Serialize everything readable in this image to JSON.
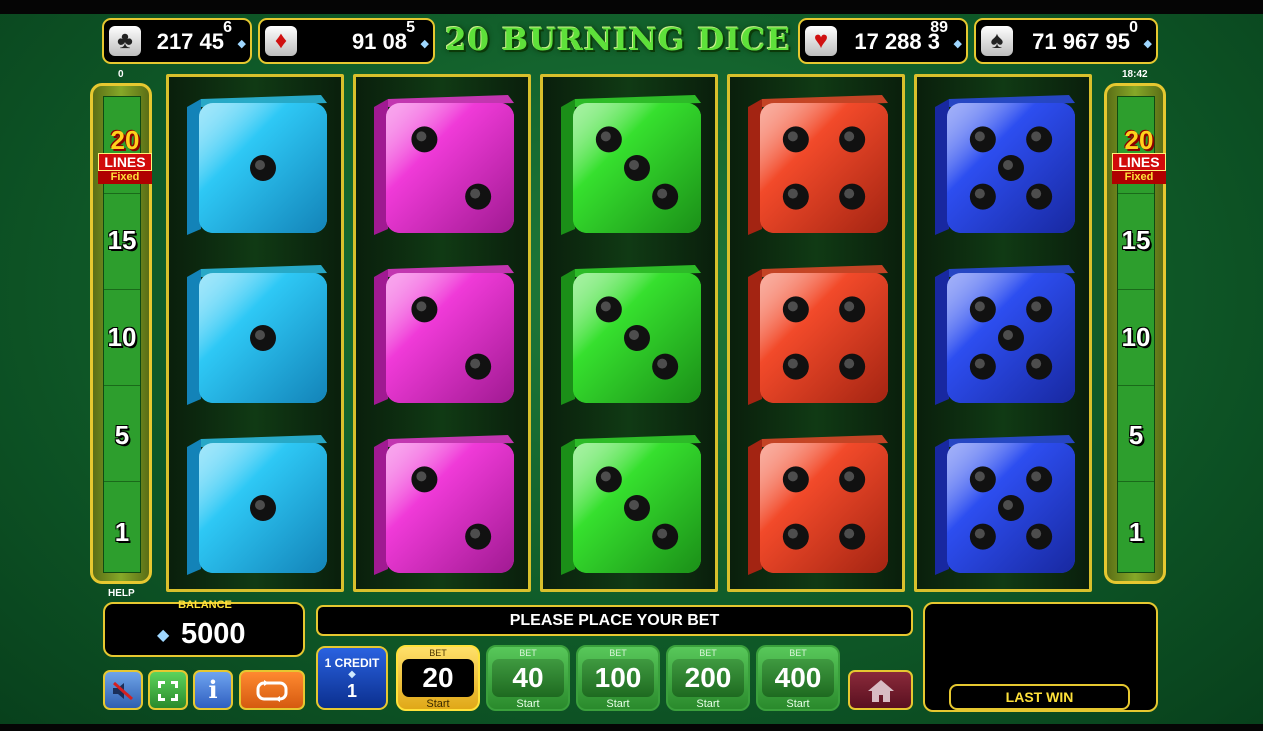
{
  "jackpots": [
    {
      "suit": "club-icon",
      "glyph": "♣",
      "amount": "217 45",
      "superscript": "6",
      "color": "#222222"
    },
    {
      "suit": "diamond-icon",
      "glyph": "♦",
      "amount": "91 08",
      "superscript": "5",
      "color": "#d01010"
    },
    {
      "suit": "heart-icon",
      "glyph": "♥",
      "amount": "17 288 3",
      "superscript": "89",
      "color": "#d01010"
    },
    {
      "suit": "spade-icon",
      "glyph": "♠",
      "amount": "71 967 95",
      "superscript": "0",
      "color": "#222222"
    }
  ],
  "title": "20 BURNING DICE",
  "left_counter": "0",
  "clock": "18:42",
  "lines_badge": {
    "number": "20",
    "lines": "LINES",
    "fixed": "Fixed"
  },
  "side_lines": [
    "15",
    "10",
    "5",
    "1"
  ],
  "reels": [
    {
      "color": "#2ec8f5",
      "dark": "#1383b8",
      "pips": [
        1,
        1,
        1
      ]
    },
    {
      "color": "#f03ad8",
      "dark": "#a01a92",
      "pips": [
        2,
        2,
        2
      ]
    },
    {
      "color": "#36e02e",
      "dark": "#1b8f18",
      "pips": [
        3,
        3,
        3
      ]
    },
    {
      "color": "#f24a2a",
      "dark": "#a32412",
      "pips": [
        4,
        4,
        4
      ]
    },
    {
      "color": "#2d4ef0",
      "dark": "#1828a0",
      "pips": [
        5,
        5,
        5
      ]
    }
  ],
  "help_label": "HELP",
  "balance": {
    "label": "BALANCE",
    "value": "5000"
  },
  "message": "PLEASE PLACE YOUR BET",
  "last_win_label": "LAST WIN",
  "credit": {
    "label": "1 CREDIT",
    "value": "1"
  },
  "bets": [
    {
      "top": "BET",
      "value": "20",
      "bottom": "Start",
      "active": true
    },
    {
      "top": "BET",
      "value": "40",
      "bottom": "Start",
      "active": false
    },
    {
      "top": "BET",
      "value": "100",
      "bottom": "Start",
      "active": false
    },
    {
      "top": "BET",
      "value": "200",
      "bottom": "Start",
      "active": false
    },
    {
      "top": "BET",
      "value": "400",
      "bottom": "Start",
      "active": false
    }
  ],
  "icons": {
    "sound": "sound-off-icon",
    "fullscreen": "fullscreen-icon",
    "info": "info-icon",
    "autoplay": "autoplay-icon",
    "home": "home-icon"
  },
  "accent": "#e6c830"
}
